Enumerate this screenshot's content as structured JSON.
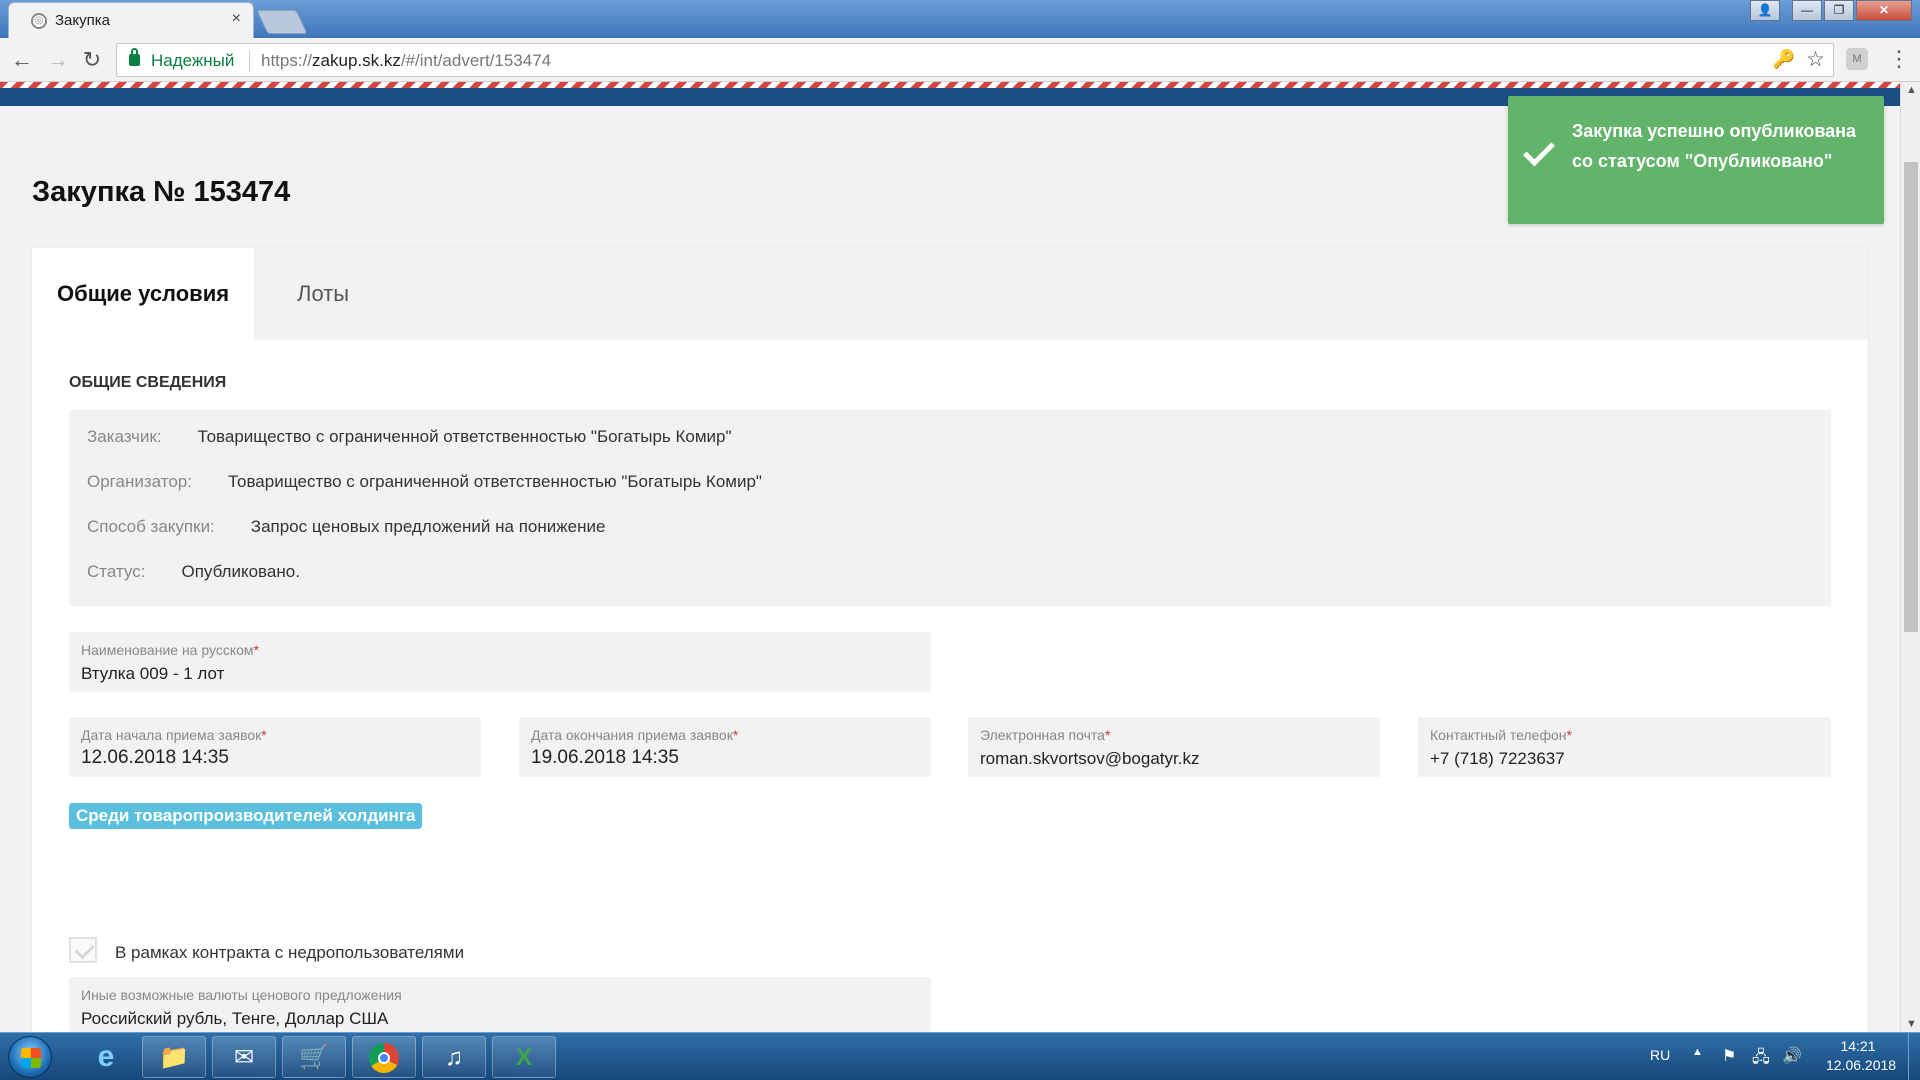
{
  "browser": {
    "tab_title": "Закупка",
    "tab_close": "×",
    "secure_label": "Надежный",
    "url_scheme": "https://",
    "url_host": "zakup.sk.kz",
    "url_path": "/#/int/advert/153474",
    "back": "←",
    "forward": "→",
    "reload": "↻",
    "menu": "⋮",
    "key": "🔑",
    "star": "☆"
  },
  "page": {
    "title": "Закупка № 153474",
    "tabs": [
      {
        "label": "Общие условия",
        "active": true
      },
      {
        "label": "Лоты",
        "active": false
      }
    ],
    "section_title": "ОБЩИЕ СВЕДЕНИЯ",
    "info": [
      {
        "label": "Заказчик:",
        "value": "Товарищество с ограниченной ответственностью \"Богатырь Комир\""
      },
      {
        "label": "Организатор:",
        "value": "Товарищество с ограниченной ответственностью \"Богатырь Комир\""
      },
      {
        "label": "Способ закупки:",
        "value": "Запрос ценовых предложений на понижение"
      },
      {
        "label": "Статус:",
        "value": "Опубликовано."
      }
    ],
    "fields": {
      "name_ru": {
        "label": "Наименование на русском",
        "required": "*",
        "value": "Втулка 009 - 1 лот"
      },
      "start_date": {
        "label": "Дата начала приема заявок",
        "required": "*",
        "value": "12.06.2018 14:35"
      },
      "end_date": {
        "label": "Дата окончания приема заявок",
        "required": "*",
        "value": "19.06.2018 14:35"
      },
      "email": {
        "label": "Электронная почта",
        "required": "*",
        "value": "roman.skvortsov@bogatyr.kz"
      },
      "phone": {
        "label": "Контактный телефон",
        "required": "*",
        "value": "+7 (718) 7223637"
      },
      "currencies": {
        "label": "Иные возможные валюты ценового предложения",
        "value": "Российский  рубль, Тенге, Доллар США"
      }
    },
    "badge": "Среди товаропроизводителей холдинга",
    "checkbox": {
      "label": "В рамках контракта с недропользователями",
      "checked": false
    }
  },
  "toast": {
    "message": "Закупка успешно опубликована со статусом \"Опубликовано\"",
    "color": "#62b46a"
  },
  "taskbar": {
    "apps": [
      "internet-explorer-icon",
      "file-explorer-icon",
      "outlook-icon",
      "shop-cart-icon",
      "chrome-icon",
      "media-app-icon",
      "excel-icon"
    ],
    "language": "RU",
    "time": "14:21",
    "date": "12.06.2018"
  },
  "colors": {
    "header_blue": "#1c4e86",
    "badge_blue": "#5bc0de",
    "required_red": "#d32f2f",
    "secure_green": "#0b8043"
  }
}
